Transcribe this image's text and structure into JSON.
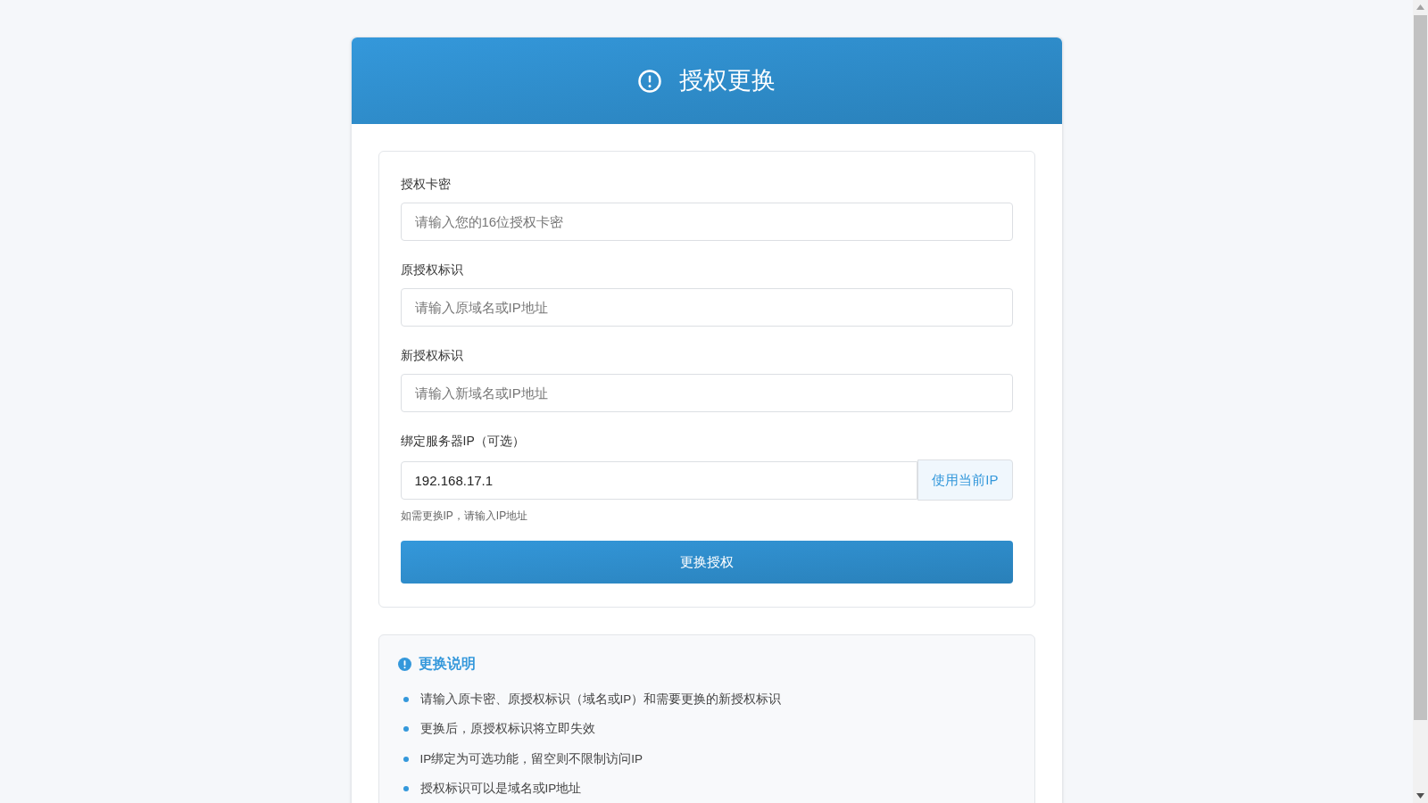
{
  "header": {
    "title": "授权更换"
  },
  "fields": [
    {
      "label": "授权卡密",
      "placeholder": "请输入您的16位授权卡密"
    },
    {
      "label": "原授权标识",
      "placeholder": "请输入原域名或IP地址"
    },
    {
      "label": "新授权标识",
      "placeholder": "请输入新域名或IP地址"
    }
  ],
  "server_ip": {
    "label": "绑定服务器IP（可选）",
    "value": "192.168.17.1",
    "button": "使用当前IP",
    "hint": "如需更换IP，请输入IP地址"
  },
  "submit_button": "更换授权",
  "notes": {
    "title": "更换说明",
    "items": [
      "请输入原卡密、原授权标识（域名或IP）和需要更换的新授权标识",
      "更换后，原授权标识将立即失效",
      "IP绑定为可选功能，留空则不限制访问IP",
      "授权标识可以是域名或IP地址"
    ]
  }
}
